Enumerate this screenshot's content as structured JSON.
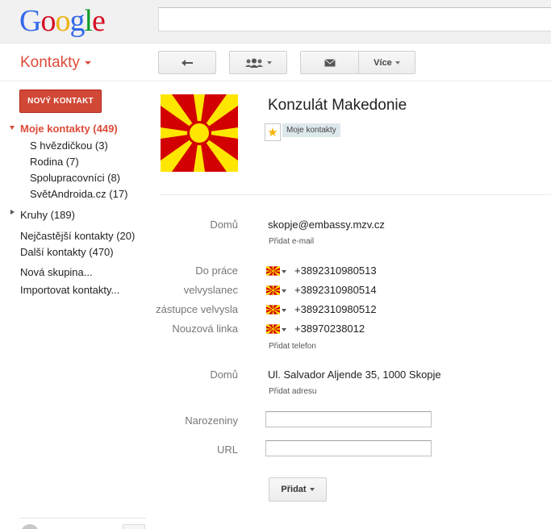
{
  "logo": {
    "letters": [
      "G",
      "o",
      "o",
      "g",
      "l",
      "e"
    ]
  },
  "search": {
    "value": ""
  },
  "header": {
    "app_title": "Kontakty",
    "more_label": "Více"
  },
  "toolbar_icons": [
    "back-arrow-icon",
    "people-icon",
    "envelope-icon"
  ],
  "sidebar": {
    "new_contact_label": "NOVÝ KONTAKT",
    "my_contacts": "Moje kontakty (449)",
    "groups": [
      "S hvězdičkou (3)",
      "Rodina (7)",
      "Spolupracovníci (8)",
      "SvětAndroida.cz (17)"
    ],
    "circles": "Kruhy (189)",
    "frequent": "Nejčastější kontakty (20)",
    "other": "Další kontakty (470)",
    "new_group": "Nová skupina...",
    "import": "Importovat kontakty..."
  },
  "contact": {
    "name": "Konzulát Makedonie",
    "group_tag": "Moje kontakty",
    "flag_colors": {
      "red": "#d20000",
      "yellow": "#ffe600"
    },
    "email": {
      "label": "Domů",
      "value": "skopje@embassy.mzv.cz",
      "add_label": "Přidat e-mail"
    },
    "phones": [
      {
        "label": "Do práce",
        "value": "+3892310980513"
      },
      {
        "label": "velvyslanec",
        "value": "+3892310980514"
      },
      {
        "label": "zástupce velvysla",
        "value": "+3892310980512"
      },
      {
        "label": "Nouzová linka",
        "value": "+38970238012"
      }
    ],
    "add_phone_label": "Přidat telefon",
    "address": {
      "label": "Domů",
      "value": "Ul. Salvador Aljende 35, 1000 Skopje",
      "add_label": "Přidat adresu"
    },
    "birthday": {
      "label": "Narozeniny",
      "value": ""
    },
    "url": {
      "label": "URL",
      "value": ""
    },
    "add_button_label": "Přidat"
  }
}
